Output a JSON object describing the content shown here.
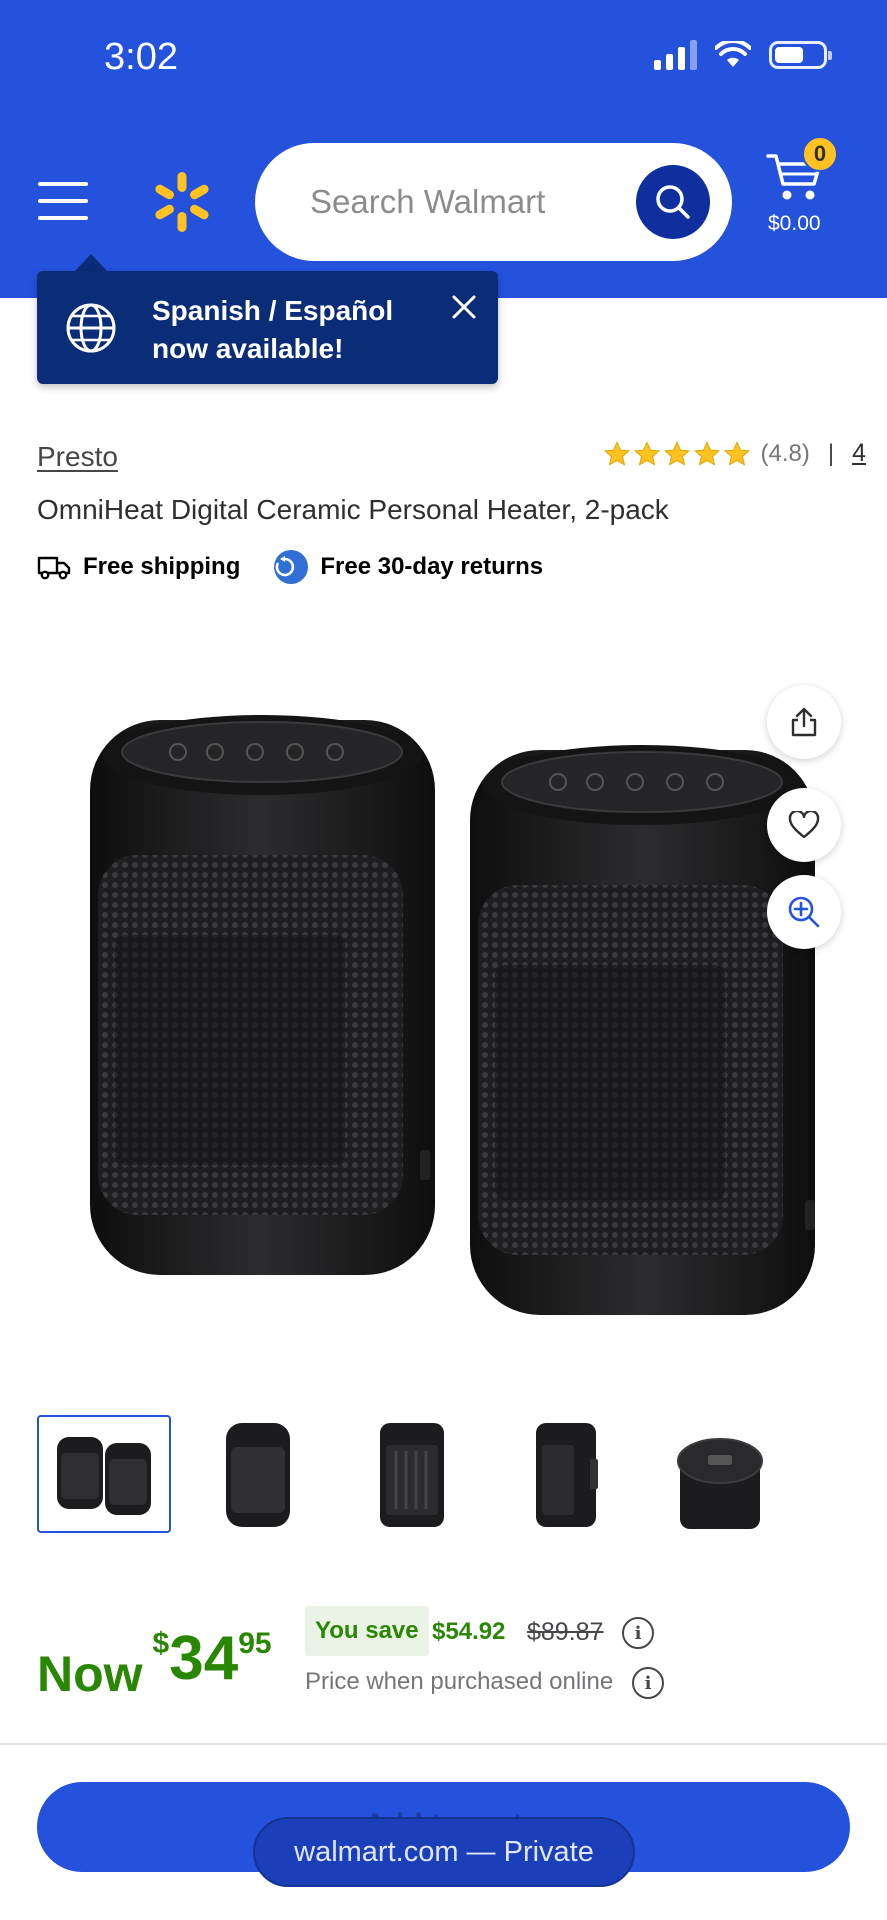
{
  "status_bar": {
    "time": "3:02"
  },
  "header": {
    "search_placeholder": "Search Walmart",
    "cart_count": "0",
    "cart_total": "$0.00",
    "brand_color": "#2452dc",
    "spark_color": "#ffc220"
  },
  "tooltip": {
    "text": "Spanish / Español now available!"
  },
  "product": {
    "brand": "Presto",
    "rating": "(4.8)",
    "stars": 5,
    "review_count": "4",
    "title": "OmniHeat Digital Ceramic Personal Heater, 2-pack",
    "perks": [
      "Free shipping",
      "Free 30-day returns"
    ],
    "thumbnail_count": 5
  },
  "price": {
    "now_label": "Now",
    "currency": "$",
    "dollars": "34",
    "cents": "95",
    "you_save_label": "You save",
    "save_amount": "$54.92",
    "was_price": "$89.87",
    "price_note": "Price when purchased online",
    "accent_color": "#2a8703"
  },
  "actions": {
    "add_to_cart": "Add to cart"
  },
  "browser": {
    "url_label": "walmart.com — Private"
  }
}
